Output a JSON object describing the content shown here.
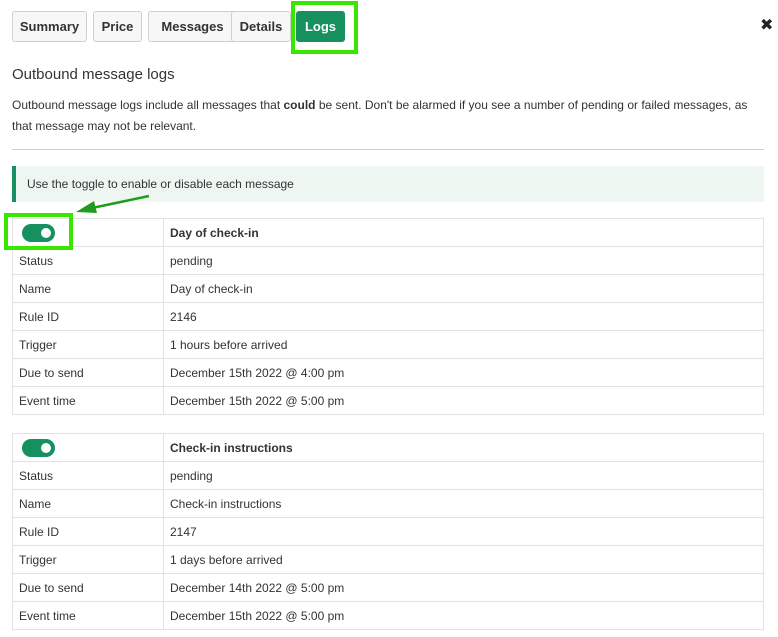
{
  "tabs": [
    {
      "label": "Summary"
    },
    {
      "label": "Price"
    },
    {
      "label": "Messages"
    },
    {
      "label": "Details"
    },
    {
      "label": "Logs",
      "active": true
    }
  ],
  "close_icon": "close-icon",
  "title": "Outbound message logs",
  "description": {
    "before": "Outbound message logs include all messages that ",
    "bold": "could",
    "after": " be sent. Don't be alarmed if you see a number of pending or failed messages, as that message may not be relevant."
  },
  "info_text": "Use the toggle to enable or disable each message",
  "colors": {
    "accent": "#17905f",
    "highlight": "#39e600",
    "arrow": "#1f9c1f"
  },
  "messages": [
    {
      "enabled": true,
      "title": "Day of check-in",
      "rows": [
        {
          "label": "Status",
          "value": "pending"
        },
        {
          "label": "Name",
          "value": "Day of check-in"
        },
        {
          "label": "Rule ID",
          "value": "2146"
        },
        {
          "label": "Trigger",
          "value": "1 hours before arrived"
        },
        {
          "label": "Due to send",
          "value": "December 15th 2022 @ 4:00 pm"
        },
        {
          "label": "Event time",
          "value": "December 15th 2022 @ 5:00 pm"
        }
      ]
    },
    {
      "enabled": true,
      "title": "Check-in instructions",
      "rows": [
        {
          "label": "Status",
          "value": "pending"
        },
        {
          "label": "Name",
          "value": "Check-in instructions"
        },
        {
          "label": "Rule ID",
          "value": "2147"
        },
        {
          "label": "Trigger",
          "value": "1 days before arrived"
        },
        {
          "label": "Due to send",
          "value": "December 14th 2022 @ 5:00 pm"
        },
        {
          "label": "Event time",
          "value": "December 15th 2022 @ 5:00 pm"
        }
      ]
    }
  ]
}
